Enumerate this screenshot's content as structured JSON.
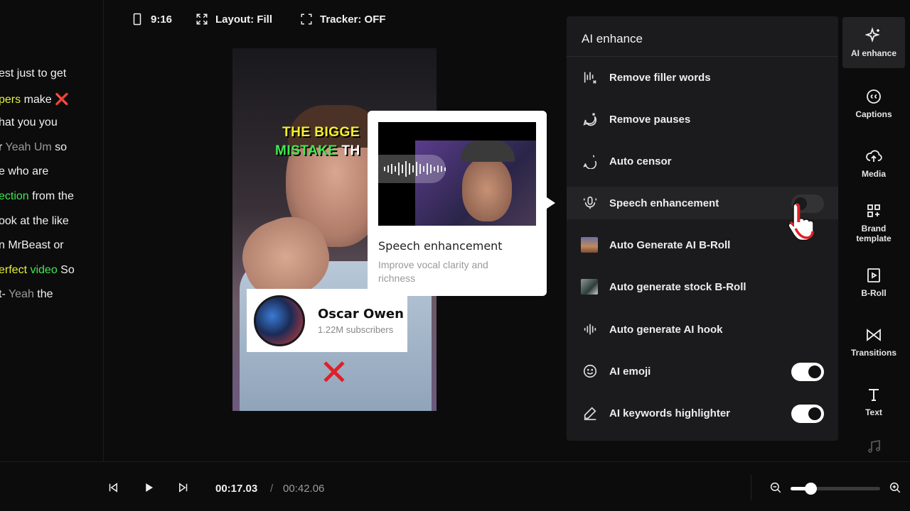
{
  "transcript": {
    "lines": [
      [
        {
          "t": "est just to get",
          "c": ""
        }
      ],
      [
        {
          "t": "pers",
          "c": "y"
        },
        {
          "t": " make ",
          "c": ""
        },
        {
          "t": "❌",
          "c": "x"
        }
      ],
      [
        {
          "t": "hat you you",
          "c": ""
        }
      ],
      [
        {
          "t": "r ",
          "c": ""
        },
        {
          "t": "Yeah Um",
          "c": "d"
        },
        {
          "t": " so",
          "c": ""
        }
      ],
      [
        {
          "t": "e who are",
          "c": ""
        }
      ],
      [
        {
          "t": "ection",
          "c": "g"
        },
        {
          "t": " from the",
          "c": ""
        }
      ],
      [
        {
          "t": "ook at the like",
          "c": ""
        }
      ],
      [
        {
          "t": "n MrBeast or",
          "c": ""
        }
      ],
      [
        {
          "t": "erfect",
          "c": "y"
        },
        {
          "t": " ",
          "c": ""
        },
        {
          "t": "video",
          "c": "g"
        },
        {
          "t": " So",
          "c": ""
        }
      ],
      [
        {
          "t": "t- ",
          "c": ""
        },
        {
          "t": "Yeah",
          "c": "d"
        },
        {
          "t": " the",
          "c": ""
        }
      ]
    ]
  },
  "toolbar": {
    "aspect": "9:16",
    "layout": "Layout: Fill",
    "tracker": "Tracker: OFF"
  },
  "video": {
    "caption_line1": "THE BIGGE",
    "caption_line2_green": "MISTAKE",
    "caption_line2_white": " TH",
    "channel_name": "Oscar Owen",
    "channel_subs": "1.22M subscribers",
    "mark": "✕"
  },
  "popup": {
    "title": "Speech enhancement",
    "description": "Improve vocal clarity and richness"
  },
  "panel": {
    "title": "AI enhance",
    "items": [
      {
        "label": "Remove filler words"
      },
      {
        "label": "Remove pauses"
      },
      {
        "label": "Auto censor"
      },
      {
        "label": "Speech enhancement"
      },
      {
        "label": "Auto Generate AI B-Roll"
      },
      {
        "label": "Auto generate stock B-Roll"
      },
      {
        "label": "Auto generate AI hook"
      },
      {
        "label": "AI emoji"
      },
      {
        "label": "AI keywords highlighter"
      }
    ]
  },
  "rail": {
    "items": [
      {
        "label": "AI enhance"
      },
      {
        "label": "Captions"
      },
      {
        "label": "Media"
      },
      {
        "label": "Brand template"
      },
      {
        "label": "B-Roll"
      },
      {
        "label": "Transitions"
      },
      {
        "label": "Text"
      }
    ]
  },
  "playback": {
    "current_time": "00:17.03",
    "separator": "/",
    "total_time": "00:42.06",
    "zoom_level": 0.22
  },
  "colors": {
    "accent_yellow": "#e7f23a",
    "accent_green": "#41e84f",
    "panel_bg": "#1b1b1d",
    "background": "#0c0c0d"
  }
}
